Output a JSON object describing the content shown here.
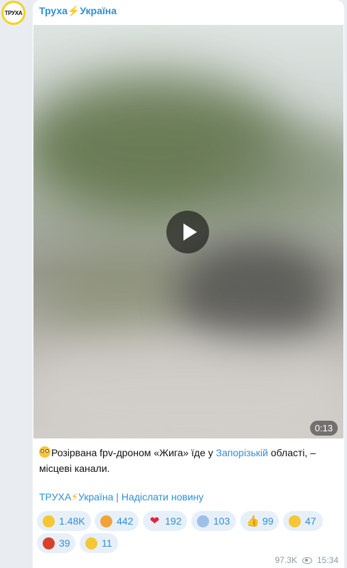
{
  "channel": {
    "name": "Труха⚡️Україна",
    "avatar_text": "ТРУХА"
  },
  "video": {
    "duration": "0:13"
  },
  "caption": {
    "part1": "Розірвана fpv-дроном «Жига» їде у ",
    "link": "Запорізькій",
    "part2": " області, – місцеві канали."
  },
  "signature": {
    "name_a": "ТРУХА",
    "name_b": "Україна",
    "separator": " | ",
    "submit_link": "Надіслати новину"
  },
  "reactions": [
    {
      "icon": "crying-face-icon",
      "count": "1.48K"
    },
    {
      "icon": "exploding-head-icon",
      "count": "442"
    },
    {
      "icon": "red-heart-icon",
      "count": "192"
    },
    {
      "icon": "screaming-face-icon",
      "count": "103"
    },
    {
      "icon": "thumbs-up-icon",
      "count": "99"
    },
    {
      "icon": "grinning-face-icon",
      "count": "47"
    },
    {
      "icon": "angry-face-icon",
      "count": "39"
    },
    {
      "icon": "confused-face-icon",
      "count": "11"
    }
  ],
  "meta": {
    "views": "97.3K",
    "time": "15:34"
  },
  "colors": {
    "link": "#2e8fd6",
    "reaction_bg": "#e7f0f9",
    "avatar_ring": "#f7d21a"
  }
}
